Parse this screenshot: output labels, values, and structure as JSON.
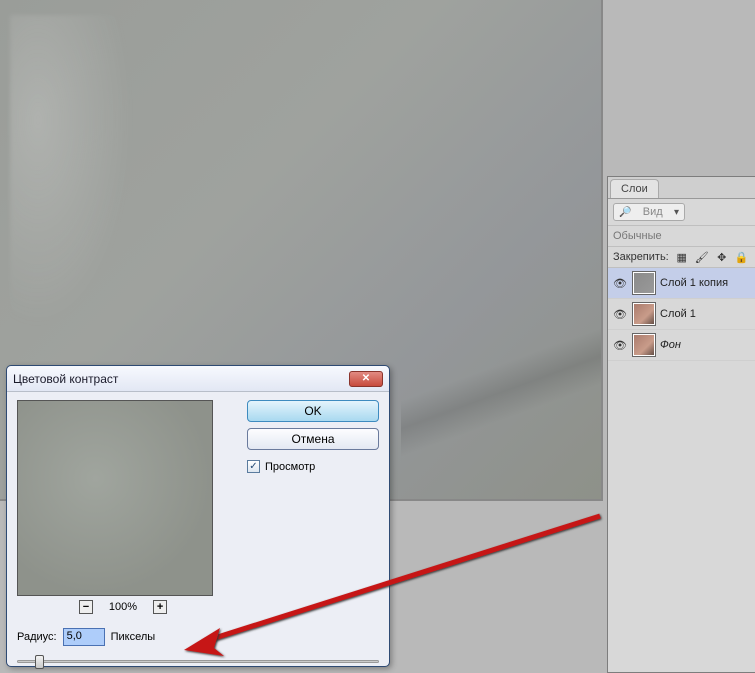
{
  "canvas": {
    "name": "filtered-image-preview"
  },
  "layers": {
    "tab_label": "Слои",
    "kind_placeholder": "Вид",
    "blend_mode": "Обычные",
    "lock_label": "Закрепить:",
    "items": [
      {
        "name": "Слой 1 копия",
        "thumb": "grey",
        "selected": true
      },
      {
        "name": "Слой 1",
        "thumb": "skin",
        "selected": false
      },
      {
        "name": "Фон",
        "thumb": "skin",
        "selected": false,
        "italic": true
      }
    ]
  },
  "dialog": {
    "title": "Цветовой контраст",
    "ok_label": "OK",
    "cancel_label": "Отмена",
    "preview_label": "Просмотр",
    "preview_checked": true,
    "zoom_text": "100%",
    "radius_label": "Радиус:",
    "radius_value": "5,0",
    "radius_unit": "Пикселы",
    "slider_position_pct": 5
  },
  "icons": {
    "search": "◯",
    "minus": "−",
    "plus": "+",
    "checkmark": "✓",
    "eye": "◉"
  }
}
